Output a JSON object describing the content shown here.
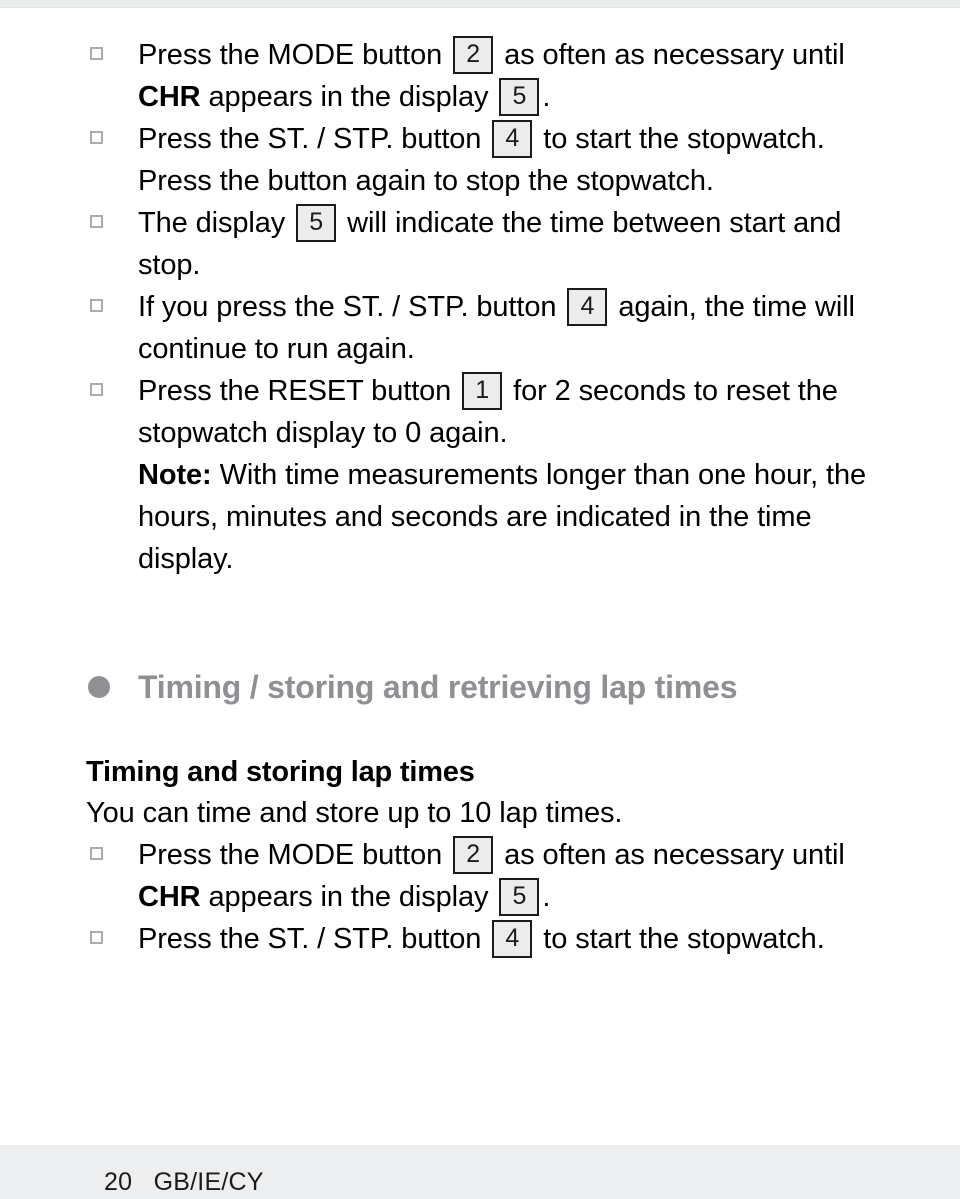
{
  "page": {
    "number": "20",
    "locale": "GB/IE/CY",
    "footer": "20   GB/IE/CY"
  },
  "colors": {
    "heading_gray": "#8e9094",
    "text_black": "#1b1b1b",
    "box_fill": "#ececec",
    "box_border": "#1b1b1b",
    "bullet_gray": "#a9abae",
    "footer_band": "#eceef0"
  },
  "stopwatch_section": {
    "items": [
      {
        "marker": "square-bullet",
        "segments": [
          {
            "type": "text",
            "value": "Press the MODE button "
          },
          {
            "type": "numbox",
            "value": "2"
          },
          {
            "type": "text",
            "value": " as often as necessary until "
          },
          {
            "type": "bold",
            "value": "CHR"
          },
          {
            "type": "text",
            "value": " appears in the display "
          },
          {
            "type": "numbox",
            "value": "5"
          },
          {
            "type": "text",
            "value": "."
          }
        ]
      },
      {
        "marker": "square-bullet",
        "segments": [
          {
            "type": "text",
            "value": "Press the ST. / STP. button "
          },
          {
            "type": "numbox",
            "value": "4"
          },
          {
            "type": "text",
            "value": " to start the stopwatch. Press the button again to stop the stopwatch."
          }
        ]
      },
      {
        "marker": "square-bullet",
        "segments": [
          {
            "type": "text",
            "value": "The display "
          },
          {
            "type": "numbox",
            "value": "5"
          },
          {
            "type": "text",
            "value": " will indicate the time between start and stop."
          }
        ]
      },
      {
        "marker": "square-bullet",
        "segments": [
          {
            "type": "text",
            "value": "If you press the ST. / STP. button "
          },
          {
            "type": "numbox",
            "value": "4"
          },
          {
            "type": "text",
            "value": " again, the time will continue to run again."
          }
        ]
      },
      {
        "marker": "square-bullet",
        "segments": [
          {
            "type": "text",
            "value": "Press the RESET button "
          },
          {
            "type": "numbox",
            "value": "1"
          },
          {
            "type": "text",
            "value": " for 2 seconds to reset the stopwatch display to 0 again."
          }
        ]
      },
      {
        "marker": "none",
        "segments": [
          {
            "type": "bold",
            "value": "Note:"
          },
          {
            "type": "text",
            "value": " With time measurements longer than one hour, the hours, minutes and seconds are indicated in the time display."
          }
        ]
      }
    ]
  },
  "lap_section": {
    "heading": "Timing / storing and retrieving lap times",
    "sub_heading": "Timing and storing lap times",
    "sub_paragraph": "You can time and store up to 10 lap times.",
    "items": [
      {
        "marker": "square-bullet",
        "segments": [
          {
            "type": "text",
            "value": "Press the MODE button "
          },
          {
            "type": "numbox",
            "value": "2"
          },
          {
            "type": "text",
            "value": " as often as necessary until "
          },
          {
            "type": "bold",
            "value": "CHR"
          },
          {
            "type": "text",
            "value": " appears in the display "
          },
          {
            "type": "numbox",
            "value": "5"
          },
          {
            "type": "text",
            "value": "."
          }
        ]
      },
      {
        "marker": "square-bullet",
        "segments": [
          {
            "type": "text",
            "value": "Press the ST. / STP. button "
          },
          {
            "type": "numbox",
            "value": "4"
          },
          {
            "type": "text",
            "value": " to start the stopwatch."
          }
        ]
      }
    ]
  }
}
